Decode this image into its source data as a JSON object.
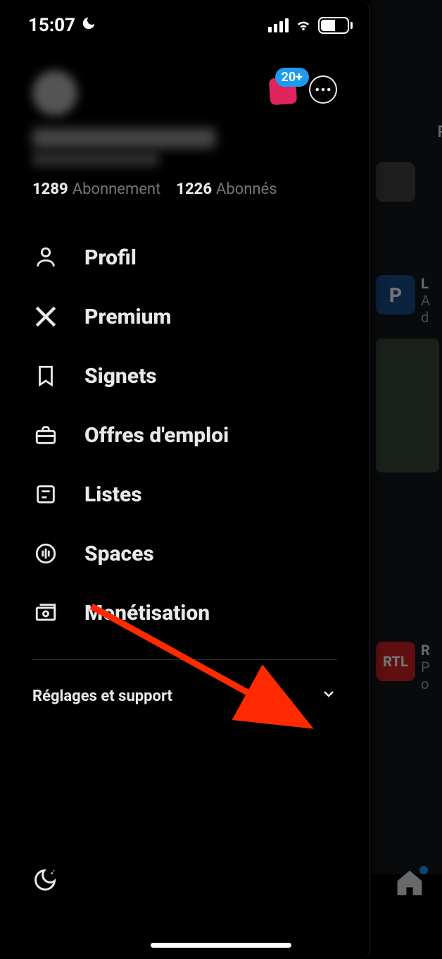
{
  "status_bar": {
    "time": "15:07",
    "battery_percent": "50"
  },
  "header": {
    "notif_badge": "20+",
    "following_count": "1289",
    "following_label": "Abonnement",
    "followers_count": "1226",
    "followers_label": "Abonnés"
  },
  "menu": {
    "profile": "Profil",
    "premium": "Premium",
    "bookmarks": "Signets",
    "jobs": "Offres d'emploi",
    "lists": "Listes",
    "spaces": "Spaces",
    "monetization": "Monétisation"
  },
  "settings_label": "Réglages et support",
  "feed": {
    "tab_label": "Po",
    "item2_avatar_letter": "P",
    "item3_avatar_text": "RTL"
  }
}
